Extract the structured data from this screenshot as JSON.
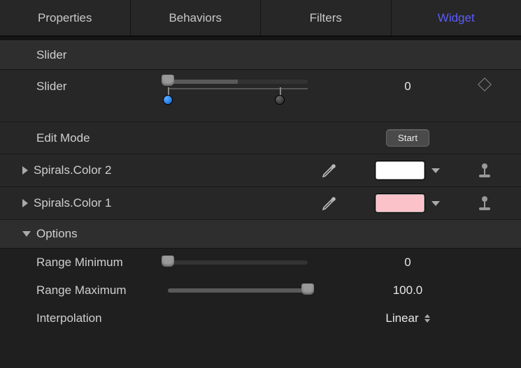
{
  "tabs": {
    "t0": "Properties",
    "t1": "Behaviors",
    "t2": "Filters",
    "t3": "Widget"
  },
  "section_title": "Slider",
  "slider": {
    "label": "Slider",
    "value": "0"
  },
  "edit_mode": {
    "label": "Edit Mode",
    "button": "Start"
  },
  "color2": {
    "label": "Spirals.Color 2",
    "hex": "#ffffff"
  },
  "color1": {
    "label": "Spirals.Color 1",
    "hex": "#fbc3c9"
  },
  "options": {
    "label": "Options",
    "range_min": {
      "label": "Range Minimum",
      "value": "0"
    },
    "range_max": {
      "label": "Range Maximum",
      "value": "100.0"
    },
    "interpolation": {
      "label": "Interpolation",
      "value": "Linear"
    }
  }
}
